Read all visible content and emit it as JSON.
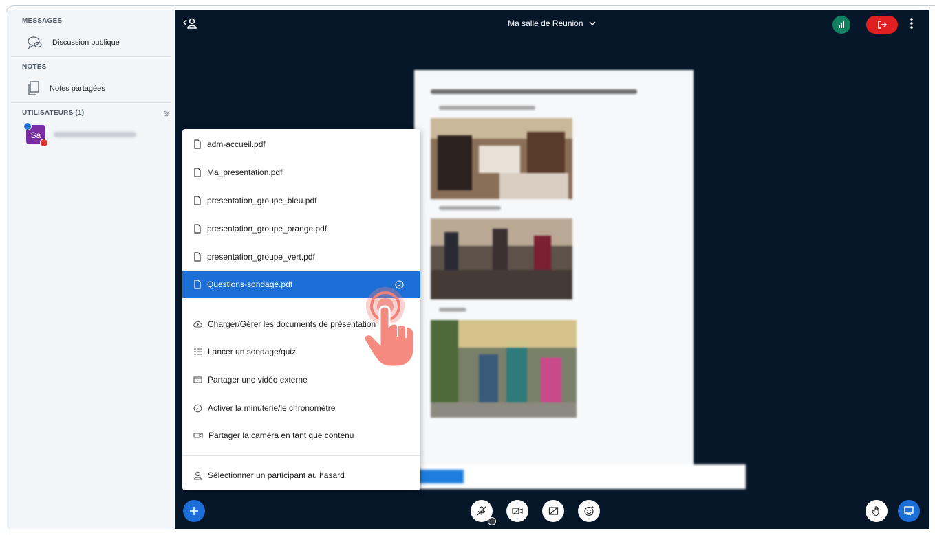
{
  "sidebar": {
    "messages_title": "MESSAGES",
    "public_chat": "Discussion publique",
    "notes_title": "NOTES",
    "shared_notes": "Notes partagées",
    "users_title": "UTILISATEURS (1)",
    "user_initials": "Sa"
  },
  "header": {
    "meeting_title": "Ma salle de Réunion"
  },
  "menu": {
    "files": [
      {
        "label": "adm-accueil.pdf"
      },
      {
        "label": "Ma_presentation.pdf"
      },
      {
        "label": "presentation_groupe_bleu.pdf"
      },
      {
        "label": "presentation_groupe_orange.pdf"
      },
      {
        "label": "presentation_groupe_vert.pdf"
      },
      {
        "label": "Questions-sondage.pdf",
        "selected": true
      }
    ],
    "actions": [
      {
        "label": "Charger/Gérer les documents de présentation",
        "icon": "upload-cloud-icon"
      },
      {
        "label": "Lancer un sondage/quiz",
        "icon": "poll-list-icon"
      },
      {
        "label": "Partager une vidéo externe",
        "icon": "external-video-icon"
      },
      {
        "label": "Activer la minuterie/le chronomètre",
        "icon": "timer-icon"
      },
      {
        "label": "Partager la caméra en tant que contenu",
        "icon": "camera-icon"
      }
    ],
    "random_user": "Sélectionner un participant au hasard"
  },
  "colors": {
    "accent": "#1b6fd6",
    "dark_bg": "#06172a",
    "leave": "#e02020",
    "connection": "#0f8060",
    "tap": "#f07f76"
  }
}
